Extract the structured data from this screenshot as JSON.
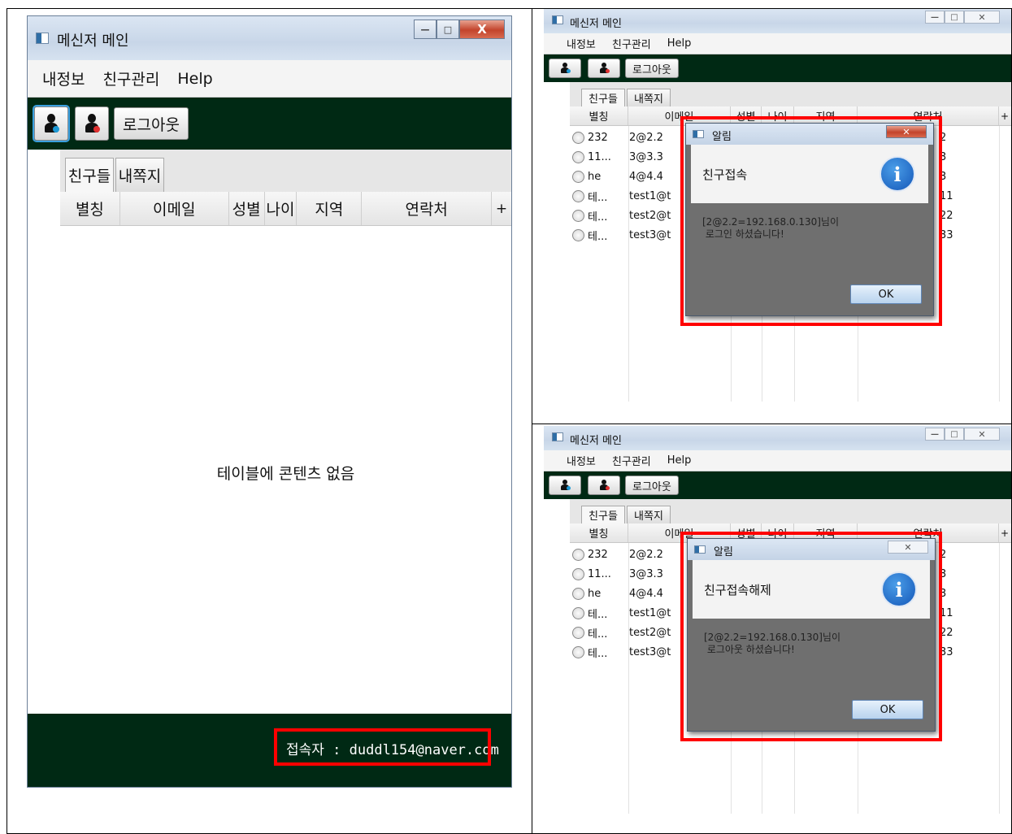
{
  "left_window": {
    "title": "메신저 메인",
    "menu": [
      "내정보",
      "친구관리",
      "Help"
    ],
    "toolbar": {
      "logout_label": "로그아웃"
    },
    "tabs": [
      "친구들",
      "내쪽지"
    ],
    "columns": [
      "별칭",
      "이메일",
      "성별",
      "나이",
      "지역",
      "연락처",
      "+"
    ],
    "empty_message": "테이블에 콘텐츠 없음",
    "status": "접속자 : duddl154@naver.com",
    "caption_buttons": {
      "minimize": "—",
      "maximize": "□",
      "close": "X"
    }
  },
  "right_top": {
    "title": "메신저 메인",
    "menu": [
      "내정보",
      "친구관리",
      "Help"
    ],
    "toolbar": {
      "logout_label": "로그아웃"
    },
    "tabs": [
      "친구들",
      "내쪽지"
    ],
    "columns": [
      "별칭",
      "이메일",
      "성별",
      "나이",
      "지역",
      "연락처",
      "+"
    ],
    "rows": [
      {
        "nick": "232",
        "email": "2@2.2",
        "phone": "2"
      },
      {
        "nick": "11...",
        "email": "3@3.3",
        "phone": "3"
      },
      {
        "nick": "he",
        "email": "4@4.4",
        "phone": "3"
      },
      {
        "nick": "테...",
        "email": "test1@t",
        "phone": "11"
      },
      {
        "nick": "테...",
        "email": "test2@t",
        "phone": "22"
      },
      {
        "nick": "테...",
        "email": "test3@t",
        "phone": "33"
      }
    ],
    "dialog": {
      "title": "알림",
      "header": "친구접속",
      "message": "[2@2.2=192.168.0.130]님이\n 로그인 하셨습니다!",
      "ok": "OK",
      "info_glyph": "i",
      "close_glyph": "✕"
    }
  },
  "right_bottom": {
    "title": "메신저 메인",
    "menu": [
      "내정보",
      "친구관리",
      "Help"
    ],
    "toolbar": {
      "logout_label": "로그아웃"
    },
    "tabs": [
      "친구들",
      "내쪽지"
    ],
    "columns": [
      "별칭",
      "이메일",
      "성별",
      "나이",
      "지역",
      "연락처",
      "+"
    ],
    "rows": [
      {
        "nick": "232",
        "email": "2@2.2",
        "phone": "2"
      },
      {
        "nick": "11...",
        "email": "3@3.3",
        "phone": "3"
      },
      {
        "nick": "he",
        "email": "4@4.4",
        "phone": "3"
      },
      {
        "nick": "테...",
        "email": "test1@t",
        "phone": "11"
      },
      {
        "nick": "테...",
        "email": "test2@t",
        "phone": "22"
      },
      {
        "nick": "테...",
        "email": "test3@t",
        "phone": "33"
      }
    ],
    "dialog": {
      "title": "알림",
      "header": "친구접속해제",
      "message": "[2@2.2=192.168.0.130]님이\n 로그아웃 하셨습니다!",
      "ok": "OK",
      "info_glyph": "i",
      "close_glyph": "✕"
    }
  },
  "colors": {
    "toolbar_bg": "#002914",
    "highlight": "#ff0000",
    "table_bg": "#ffffff"
  }
}
